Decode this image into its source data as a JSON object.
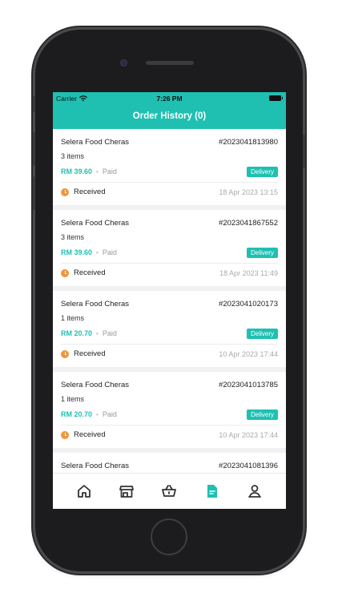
{
  "status_bar": {
    "carrier": "Carrier",
    "time": "7:26 PM"
  },
  "header": {
    "title": "Order History (0)"
  },
  "orders": [
    {
      "store": "Selera Food Cheras",
      "order_no": "#2023041813980",
      "items": "3 items",
      "price": "RM 39.60",
      "payment": "Paid",
      "type": "Delivery",
      "status": "Received",
      "date": "18 Apr 2023 13:15"
    },
    {
      "store": "Selera Food Cheras",
      "order_no": "#2023041867552",
      "items": "3 items",
      "price": "RM 39.60",
      "payment": "Paid",
      "type": "Delivery",
      "status": "Received",
      "date": "18 Apr 2023 11:49"
    },
    {
      "store": "Selera Food Cheras",
      "order_no": "#2023041020173",
      "items": "1 items",
      "price": "RM 20.70",
      "payment": "Paid",
      "type": "Delivery",
      "status": "Received",
      "date": "10 Apr 2023 17:44"
    },
    {
      "store": "Selera Food Cheras",
      "order_no": "#2023041013785",
      "items": "1 items",
      "price": "RM 20.70",
      "payment": "Paid",
      "type": "Delivery",
      "status": "Received",
      "date": "10 Apr 2023 17:44"
    },
    {
      "store": "Selera Food Cheras",
      "order_no": "#2023041081396",
      "items": "",
      "price": "",
      "payment": "",
      "type": "",
      "status": "",
      "date": ""
    }
  ],
  "tab_bar": {
    "tabs": [
      {
        "icon": "home-icon",
        "active": false
      },
      {
        "icon": "store-icon",
        "active": false
      },
      {
        "icon": "basket-icon",
        "active": false
      },
      {
        "icon": "document-icon",
        "active": true
      },
      {
        "icon": "user-icon",
        "active": false
      }
    ]
  },
  "colors": {
    "accent": "#1fc0b2",
    "status_orange": "#f0963a",
    "inactive_icon": "#333333"
  }
}
